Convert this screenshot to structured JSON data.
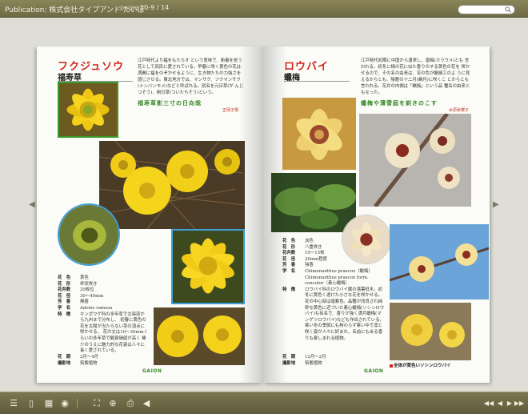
{
  "topbar": {
    "publication_title": "Publication: 株式会社タイプアンド たいぼ",
    "pages_label": "pages:",
    "pages_value": "10-9 / 14",
    "search_placeholder": ""
  },
  "left_page": {
    "title": "フクジュソウ",
    "kanji": "福寿草",
    "description": "江戸時代より福をもたらす という意味で、新春を祝う 花として庶民に愛されている。早春に咲く黄色の花は 満開に福をのぞかせるように、生き物たちの力強さを 感じさせる。東北地方では、マンサク、フクマンサク (ナンバンモメ)などと呼ばれる。別名を元日草(が んじつそう)、朔日草(ついたちそう)という。",
    "haiku": "福寿草影三寸の日向哉",
    "haiku_author": "正岡子規",
    "info": [
      {
        "key": "花　色",
        "val": "黄色"
      },
      {
        "key": "花　形",
        "val": "杯状咲き"
      },
      {
        "key": "花弁数",
        "val": "20枚位"
      },
      {
        "key": "花　径",
        "val": "30〜40mm"
      },
      {
        "key": "芳　香",
        "val": "無香"
      },
      {
        "key": "学　名",
        "val": "Adonis ramosa"
      },
      {
        "key": "特　徴",
        "val": "キンポウゲ科の多年草で北海道から九州まで分布し、 初春に黄色の花を太陽が当たらない茎の頂点に咲かせる。 花の丈は10〜30mmくらいの多年草で観賞価値が高く 稀少のうえに魅力的な花姿は人々に長く愛されている。"
      }
    ],
    "bloom_label": "花　期",
    "bloom_value": "2月〜4月",
    "photographer_label": "撮影地",
    "photographer_value": "筑紫植物",
    "logo": "GAION"
  },
  "right_page": {
    "title": "ロウバイ",
    "kanji": "蠟梅",
    "description": "江戸時代初期に中国から渡来し、唐梅(カラウメ)とも 言われる。初冬に梅の花に似た香りのする黄色の花を 咲かせるので、その名の由来は、花の色が蠟細工のよ うに見えるからとも、陰暦の十二月(蝋月)に咲くこ とからとも言われる。花弁の内側は「蝋梅」という品 種名の由来ともなった。",
    "haiku": "蠟梅や薄雪庭を剃きのこす",
    "haiku_author": "水原秋櫻子",
    "info": [
      {
        "key": "花　色",
        "val": "淡色"
      },
      {
        "key": "花　形",
        "val": "八重咲き"
      },
      {
        "key": "花弁数",
        "val": "10〜15枚"
      },
      {
        "key": "花　径",
        "val": "20mm程度"
      },
      {
        "key": "芳　香",
        "val": "強香"
      },
      {
        "key": "学　名",
        "val": "Chimonanthus praecox（蠟梅）"
      },
      {
        "key": "",
        "val": "Chimonanthus praecox form. concolor（素心蠟梅）"
      },
      {
        "key": "特　徴",
        "val": "ロウバイ科のロウバイ属の落葉低木。初冬に黄色く透けた小さな花を咲かせる。花の中心部は暗紫色。品種が改良され純粋な黄色に近づいた素心蠟梅(ソシンロウバイ)も有名で、香りが強く満月蠟梅(マンゲツロウバイ)なども作出されている。寒い冬の季節にも拘わらず寒い中で凛と咲く姿が人々に好まれ、名前にもある香りも楽しまれる植物。"
      }
    ],
    "bloom_label": "花　期",
    "bloom_value": "12月〜2月",
    "photographer_label": "撮影地",
    "photographer_value": "筑紫植物",
    "logo": "GAION",
    "caption": "全体が黄色いソシンロウバイ"
  },
  "toolbar": {
    "icons": [
      "list-icon",
      "book-icon",
      "grid-icon",
      "share-icon",
      "fullscreen-icon",
      "zoom-icon",
      "print-icon",
      "sound-icon"
    ],
    "nav_icons": [
      "first-page-icon",
      "prev-page-icon",
      "next-page-icon",
      "last-page-icon"
    ]
  },
  "colors": {
    "toolbar": "#6e6a45",
    "title_red": "#d1261c",
    "haiku_green": "#3a8a28",
    "photo_border_green": "#3a9a2a",
    "photo_border_blue": "#3fa0d8"
  }
}
